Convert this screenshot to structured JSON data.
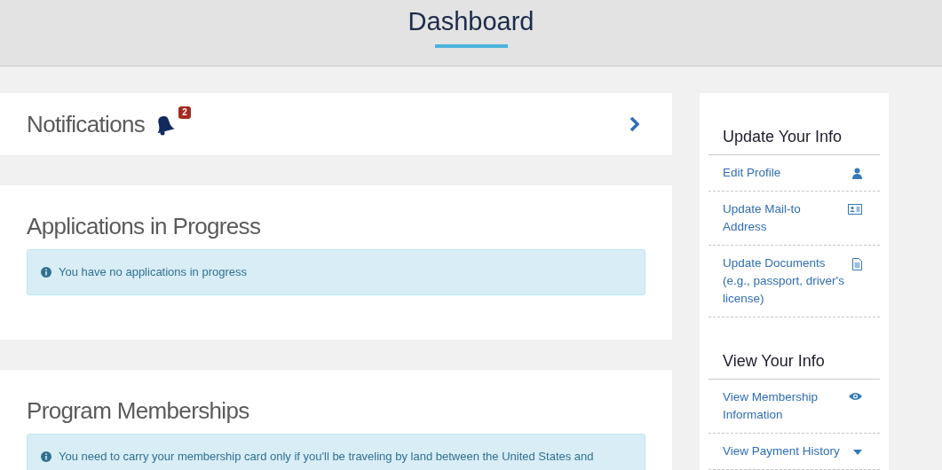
{
  "header": {
    "title": "Dashboard"
  },
  "notifications": {
    "title": "Notifications",
    "count": "2"
  },
  "sections": [
    {
      "title": "Applications in Progress",
      "alert": "You have no applications in progress"
    },
    {
      "title": "Program Memberships",
      "alert": "You need to carry your membership card only if you'll be traveling by land between the United States and"
    }
  ],
  "sidebar": [
    {
      "title": "Update Your Info",
      "links": [
        {
          "label": "Edit Profile",
          "kind": "person"
        },
        {
          "label": "Update Mail-to Address",
          "kind": "card"
        },
        {
          "label": "Update Documents (e.g., passport, driver's license)",
          "kind": "document"
        }
      ]
    },
    {
      "title": "View Your Info",
      "links": [
        {
          "label": "View Membership Information",
          "kind": "eye"
        },
        {
          "label": "View Payment History",
          "kind": "dropdown"
        }
      ]
    }
  ]
}
